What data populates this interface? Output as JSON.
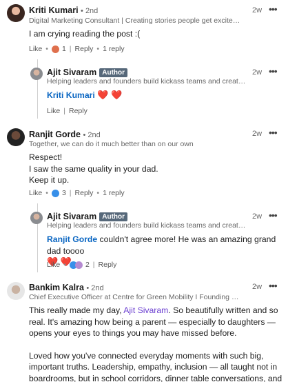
{
  "comments": [
    {
      "name": "Kriti Kumari",
      "degree": "• 2nd",
      "headline": "Digital Marketing Consultant | Creating stories people get excited about | Fe...",
      "time": "2w",
      "text": "I am crying reading the post :(",
      "actions": {
        "like": "Like",
        "reaction_count": "1",
        "reply": "Reply",
        "replies": "1 reply"
      },
      "reply": {
        "name": "Ajit Sivaram",
        "badge": "Author",
        "headline": "Helping leaders and founders build kickass teams and create winning ...",
        "time": "2w",
        "mention": "Kriti Kumari",
        "hearts": "❤️ ❤️",
        "actions": {
          "like": "Like",
          "reply": "Reply"
        }
      }
    },
    {
      "name": "Ranjit Gorde",
      "degree": "• 2nd",
      "headline": "Together, we can do it much better than on our own",
      "time": "2w",
      "lines": [
        "Respect!",
        "I saw the same quality in your dad.",
        "Keep it up."
      ],
      "actions": {
        "like": "Like",
        "reaction_count": "3",
        "reply": "Reply",
        "replies": "1 reply"
      },
      "reply": {
        "name": "Ajit Sivaram",
        "badge": "Author",
        "headline": "Helping leaders and founders build kickass teams and create winning ...",
        "time": "2w",
        "mention": "Ranjit Gorde",
        "text": " couldn't agree more! He was an amazing grand dad toooo",
        "hearts": "❤️ ❤️",
        "actions": {
          "like": "Like",
          "reaction_count": "2",
          "reply": "Reply"
        }
      }
    },
    {
      "name": "Bankim Kalra",
      "degree": "• 2nd",
      "headline": "Chief Executive Officer at Centre for Green Mobility I Founding Director, Qua...",
      "time": "2w",
      "p1_before": "This really made my day, ",
      "p1_mention": "Ajit Sivaram",
      "p1_after": ". So beautifully written and so real. It's amazing how being a parent — especially to daughters — opens your eyes to things you may have missed before.",
      "p2": "Loved how you've connected everyday moments with such big, important truths. Leadership, empathy, inclusion — all taught not in boardrooms, but in school corridors, dinner table conversations, and daily life."
    }
  ],
  "colors": {
    "link": "#0a66c2",
    "heart": "#d11124",
    "author_badge": "#56687a"
  }
}
